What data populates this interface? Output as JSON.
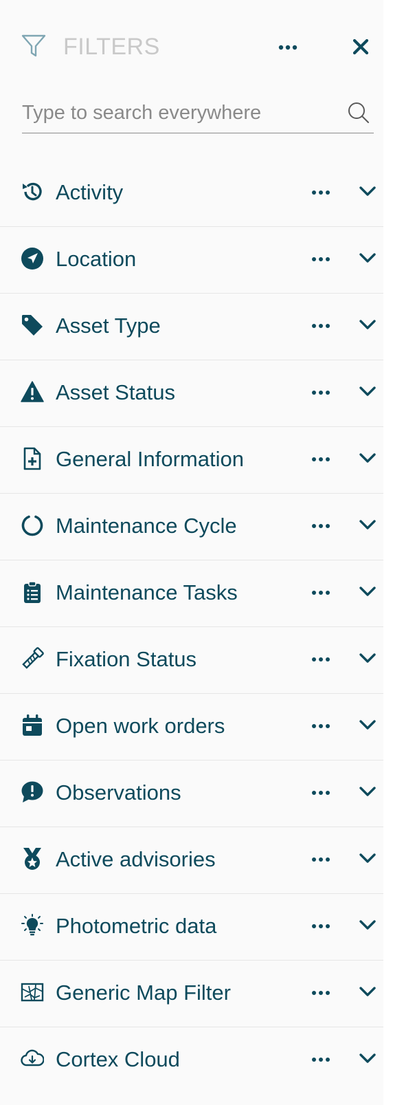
{
  "header": {
    "title": "FILTERS",
    "more_icon": "more-horizontal-icon",
    "close_icon": "close-icon",
    "filter_icon": "funnel-icon"
  },
  "search": {
    "placeholder": "Type to search everywhere",
    "value": "",
    "icon": "search-icon"
  },
  "colors": {
    "primary": "#0e4a5c",
    "muted_title": "#c9c9c9",
    "divider": "#e6e6e6",
    "background": "#fafafa"
  },
  "filters": [
    {
      "label": "Activity",
      "icon": "history-icon"
    },
    {
      "label": "Location",
      "icon": "location-arrow-icon"
    },
    {
      "label": "Asset Type",
      "icon": "tag-icon"
    },
    {
      "label": "Asset Status",
      "icon": "warning-triangle-icon"
    },
    {
      "label": "General Information",
      "icon": "file-medical-icon"
    },
    {
      "label": "Maintenance Cycle",
      "icon": "circle-notch-icon"
    },
    {
      "label": "Maintenance Tasks",
      "icon": "clipboard-list-icon"
    },
    {
      "label": "Fixation Status",
      "icon": "bolt-screw-icon"
    },
    {
      "label": "Open work orders",
      "icon": "calendar-icon"
    },
    {
      "label": "Observations",
      "icon": "comment-alert-icon"
    },
    {
      "label": "Active advisories",
      "icon": "medal-icon"
    },
    {
      "label": "Photometric data",
      "icon": "lightbulb-icon"
    },
    {
      "label": "Generic Map Filter",
      "icon": "map-icon"
    },
    {
      "label": "Cortex Cloud",
      "icon": "cloud-download-icon"
    }
  ]
}
